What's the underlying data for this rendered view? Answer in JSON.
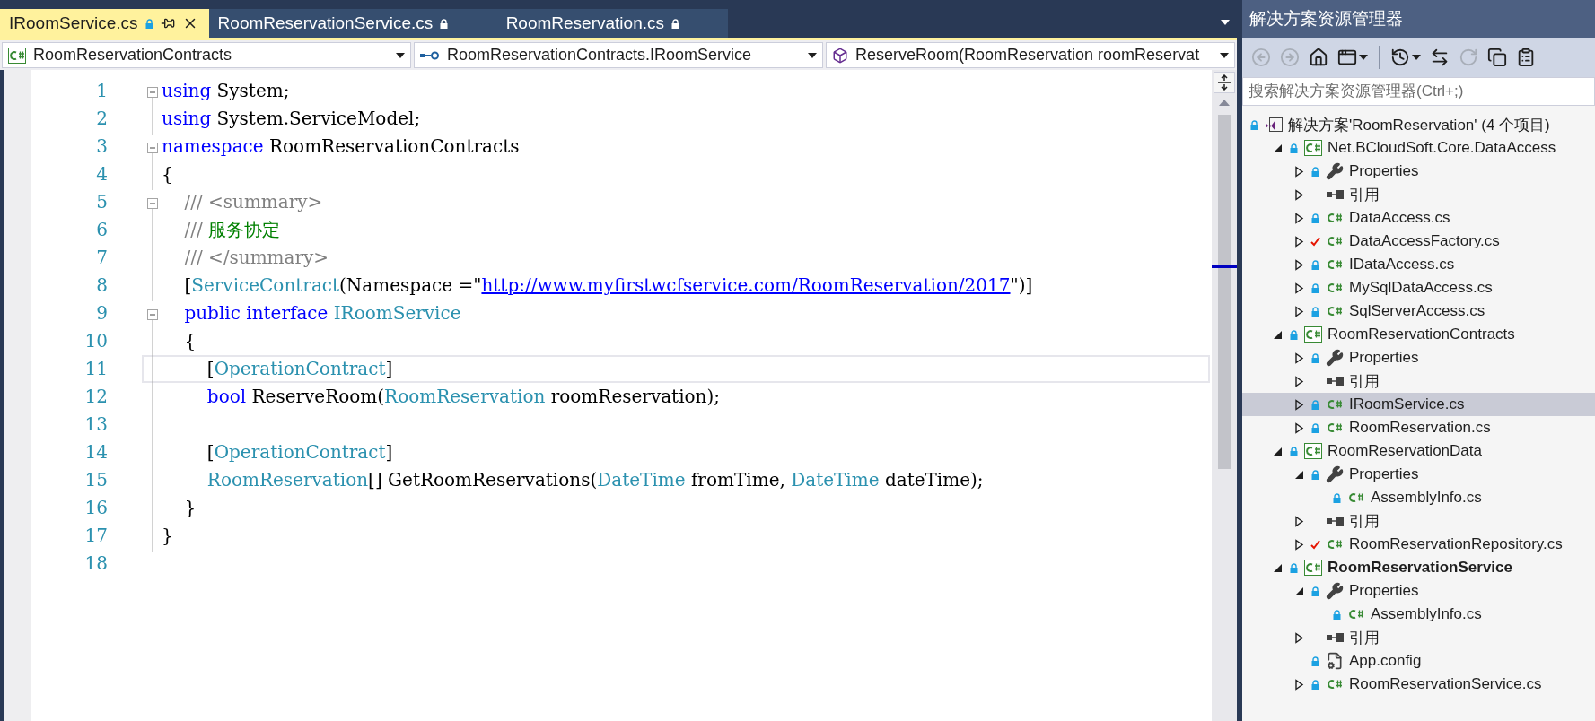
{
  "tabs": [
    {
      "label": "IRoomService.cs",
      "selected": true,
      "locked": true
    },
    {
      "label": "RoomReservationService.cs",
      "selected": false,
      "locked": true
    },
    {
      "label": "RoomReservation.cs",
      "selected": false,
      "locked": true
    }
  ],
  "nav": [
    {
      "kind": "project",
      "text": "RoomReservationContracts"
    },
    {
      "kind": "interface",
      "text": "RoomReservationContracts.IRoomService"
    },
    {
      "kind": "method",
      "text": "ReserveRoom(RoomReservation roomReservat"
    }
  ],
  "code": [
    {
      "number": "1",
      "foldable": true,
      "current": false,
      "tokens": [
        {
          "kind": "keyword",
          "text": "using"
        },
        {
          "kind": "plain",
          "text": " System;"
        }
      ]
    },
    {
      "number": "2",
      "foldable": false,
      "current": false,
      "tokens": [
        {
          "kind": "keyword",
          "text": "using"
        },
        {
          "kind": "plain",
          "text": " System.ServiceModel;"
        }
      ]
    },
    {
      "number": "3",
      "foldable": true,
      "current": false,
      "tokens": [
        {
          "kind": "keyword",
          "text": "namespace"
        },
        {
          "kind": "plain",
          "text": " RoomReservationContracts"
        }
      ]
    },
    {
      "number": "4",
      "foldable": false,
      "current": false,
      "tokens": [
        {
          "kind": "plain",
          "text": "{"
        }
      ]
    },
    {
      "number": "5",
      "foldable": true,
      "current": false,
      "tokens": [
        {
          "kind": "comment",
          "text": "    /// <summary>"
        }
      ]
    },
    {
      "number": "6",
      "foldable": false,
      "current": false,
      "tokens": [
        {
          "kind": "comment",
          "text": "    /// "
        },
        {
          "kind": "doc",
          "text": "服务协定"
        }
      ]
    },
    {
      "number": "7",
      "foldable": false,
      "current": false,
      "tokens": [
        {
          "kind": "comment",
          "text": "    /// </summary>"
        }
      ]
    },
    {
      "number": "8",
      "foldable": false,
      "current": false,
      "tokens": [
        {
          "kind": "plain",
          "text": "    ["
        },
        {
          "kind": "type",
          "text": "ServiceContract"
        },
        {
          "kind": "plain",
          "text": "(Namespace =\""
        },
        {
          "kind": "link",
          "text": "http://www.myfirstwcfservice.com/RoomReservation/2017"
        },
        {
          "kind": "plain",
          "text": "\")]"
        }
      ]
    },
    {
      "number": "9",
      "foldable": true,
      "current": false,
      "tokens": [
        {
          "kind": "keyword",
          "text": "    public interface"
        },
        {
          "kind": "type",
          "text": " IRoomService"
        }
      ]
    },
    {
      "number": "10",
      "foldable": false,
      "current": false,
      "tokens": [
        {
          "kind": "plain",
          "text": "    {"
        }
      ]
    },
    {
      "number": "11",
      "foldable": false,
      "current": true,
      "tokens": [
        {
          "kind": "plain",
          "text": "        ["
        },
        {
          "kind": "type",
          "text": "OperationContract"
        },
        {
          "kind": "plain",
          "text": "]"
        }
      ]
    },
    {
      "number": "12",
      "foldable": false,
      "current": false,
      "tokens": [
        {
          "kind": "keyword",
          "text": "        bool"
        },
        {
          "kind": "plain",
          "text": " ReserveRoom("
        },
        {
          "kind": "type",
          "text": "RoomReservation"
        },
        {
          "kind": "plain",
          "text": " roomReservation);"
        }
      ]
    },
    {
      "number": "13",
      "foldable": false,
      "current": false
    },
    {
      "number": "14",
      "foldable": false,
      "current": false,
      "tokens": [
        {
          "kind": "plain",
          "text": "        ["
        },
        {
          "kind": "type",
          "text": "OperationContract"
        },
        {
          "kind": "plain",
          "text": "]"
        }
      ]
    },
    {
      "number": "15",
      "foldable": false,
      "current": false,
      "tokens": [
        {
          "kind": "type",
          "text": "        RoomReservation"
        },
        {
          "kind": "plain",
          "text": "[] GetRoomReservations("
        },
        {
          "kind": "type",
          "text": "DateTime"
        },
        {
          "kind": "plain",
          "text": " fromTime, "
        },
        {
          "kind": "type",
          "text": "DateTime"
        },
        {
          "kind": "plain",
          "text": " dateTime);"
        }
      ]
    },
    {
      "number": "16",
      "foldable": false,
      "current": false,
      "tokens": [
        {
          "kind": "plain",
          "text": "    }"
        }
      ]
    },
    {
      "number": "17",
      "foldable": false,
      "current": false,
      "tokens": [
        {
          "kind": "plain",
          "text": "}"
        }
      ]
    },
    {
      "number": "18",
      "foldable": false,
      "current": false
    }
  ],
  "explorer": {
    "title": "解决方案资源管理器",
    "toolbar": [
      {
        "kind": "back",
        "disabled": true
      },
      {
        "kind": "forward",
        "disabled": true
      },
      {
        "kind": "home",
        "disabled": false
      },
      {
        "kind": "sync",
        "disabled": false,
        "dropdown": true
      },
      {
        "kind": "separator"
      },
      {
        "kind": "history",
        "disabled": false,
        "dropdown": true
      },
      {
        "kind": "swap",
        "disabled": false
      },
      {
        "kind": "refresh",
        "disabled": true
      },
      {
        "kind": "collapse",
        "disabled": false
      },
      {
        "kind": "properties",
        "disabled": false
      },
      {
        "kind": "separator"
      }
    ],
    "search": {
      "placeholder": "搜索解决方案资源管理器(Ctrl+;)"
    },
    "tree": [
      {
        "label": "解决方案'RoomReservation' (4 个项目)",
        "kind": "solution",
        "checked_out": false,
        "selected": false,
        "children": [
          {
            "label": "Net.BCloudSoft.Core.DataAccess",
            "kind": "project",
            "checked_out": false,
            "selected": false,
            "expanded": true,
            "startup": false,
            "children": [
              {
                "label": "Properties",
                "kind": "properties",
                "checked_out": false,
                "selected": false,
                "expanded": false
              },
              {
                "label": "引用",
                "kind": "references",
                "selected": false,
                "expanded": false
              },
              {
                "label": "DataAccess.cs",
                "kind": "csharp",
                "checked_out": false,
                "selected": false,
                "expanded": false
              },
              {
                "label": "DataAccessFactory.cs",
                "kind": "csharp",
                "checked_out": true,
                "selected": false,
                "expanded": false
              },
              {
                "label": "IDataAccess.cs",
                "kind": "csharp",
                "checked_out": false,
                "selected": false,
                "expanded": false
              },
              {
                "label": "MySqlDataAccess.cs",
                "kind": "csharp",
                "checked_out": false,
                "selected": false,
                "expanded": false
              },
              {
                "label": "SqlServerAccess.cs",
                "kind": "csharp",
                "checked_out": false,
                "selected": false,
                "expanded": false
              }
            ]
          },
          {
            "label": "RoomReservationContracts",
            "kind": "project",
            "checked_out": false,
            "selected": false,
            "expanded": true,
            "startup": false,
            "children": [
              {
                "label": "Properties",
                "kind": "properties",
                "checked_out": false,
                "selected": false,
                "expanded": false
              },
              {
                "label": "引用",
                "kind": "references",
                "selected": false,
                "expanded": false
              },
              {
                "label": "IRoomService.cs",
                "kind": "csharp",
                "checked_out": false,
                "selected": true,
                "expanded": false
              },
              {
                "label": "RoomReservation.cs",
                "kind": "csharp",
                "checked_out": false,
                "selected": false,
                "expanded": false
              }
            ]
          },
          {
            "label": "RoomReservationData",
            "kind": "project",
            "checked_out": false,
            "selected": false,
            "expanded": true,
            "startup": false,
            "children": [
              {
                "label": "Properties",
                "kind": "properties",
                "checked_out": false,
                "selected": false,
                "expanded": true,
                "children": [
                  {
                    "label": "AssemblyInfo.cs",
                    "kind": "csharp",
                    "checked_out": false,
                    "selected": false
                  }
                ]
              },
              {
                "label": "引用",
                "kind": "references",
                "selected": false,
                "expanded": false
              },
              {
                "label": "RoomReservationRepository.cs",
                "kind": "csharp",
                "checked_out": true,
                "selected": false,
                "expanded": false
              }
            ]
          },
          {
            "label": "RoomReservationService",
            "kind": "project",
            "checked_out": false,
            "selected": false,
            "expanded": true,
            "startup": true,
            "children": [
              {
                "label": "Properties",
                "kind": "properties",
                "checked_out": false,
                "selected": false,
                "expanded": true,
                "children": [
                  {
                    "label": "AssemblyInfo.cs",
                    "kind": "csharp",
                    "checked_out": false,
                    "selected": false
                  }
                ]
              },
              {
                "label": "引用",
                "kind": "references",
                "selected": false,
                "expanded": false
              },
              {
                "label": "App.config",
                "kind": "config",
                "checked_out": false,
                "selected": false
              },
              {
                "label": "RoomReservationService.cs",
                "kind": "csharp",
                "checked_out": false,
                "selected": false,
                "expanded": false
              }
            ]
          }
        ]
      }
    ]
  }
}
